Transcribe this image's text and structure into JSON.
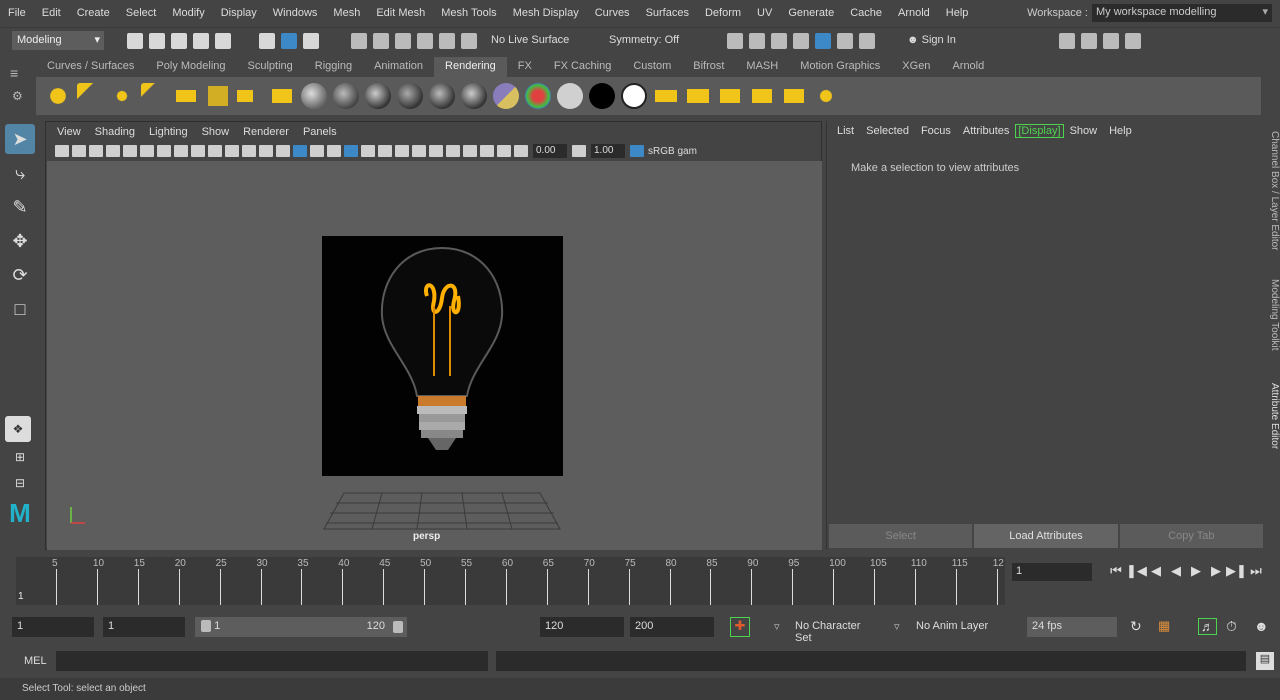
{
  "menubar": {
    "items": [
      "File",
      "Edit",
      "Create",
      "Select",
      "Modify",
      "Display",
      "Windows",
      "Mesh",
      "Edit Mesh",
      "Mesh Tools",
      "Mesh Display",
      "Curves",
      "Surfaces",
      "Deform",
      "UV",
      "Generate",
      "Cache",
      "Arnold",
      "Help"
    ],
    "workspace_label": "Workspace :",
    "workspace_value": "My workspace modelling"
  },
  "statusline": {
    "mode": "Modeling",
    "live_surface": "No Live Surface",
    "symmetry": "Symmetry: Off",
    "sign_in": "Sign In"
  },
  "shelf": {
    "tabs": [
      "Curves / Surfaces",
      "Poly Modeling",
      "Sculpting",
      "Rigging",
      "Animation",
      "Rendering",
      "FX",
      "FX Caching",
      "Custom",
      "Bifrost",
      "MASH",
      "Motion Graphics",
      "XGen",
      "Arnold"
    ],
    "active_tab": "Rendering",
    "icon_colors": [
      "#f0c419",
      "#f0c419",
      "#f0c419",
      "#f0c419",
      "#f0c419",
      "#f0c419",
      "#f0c419",
      "#f0c419",
      "#c8c8c8",
      "#a0a0a0",
      "#a8a8a8",
      "#9a9a9a",
      "#a0a0a0",
      "#9c9c9c",
      "#8a7dbb",
      "#e04040",
      "#d0d0d0",
      "#000000",
      "#ffffff",
      "#f0c419",
      "#f0c419",
      "#f0c419",
      "#f0c419",
      "#f0c419",
      "#f0c419"
    ]
  },
  "viewport": {
    "menu": [
      "View",
      "Shading",
      "Lighting",
      "Show",
      "Renderer",
      "Panels"
    ],
    "field_a": "0.00",
    "field_b": "1.00",
    "color_space": "sRGB gam",
    "camera": "persp"
  },
  "attribute_editor": {
    "menu": [
      "List",
      "Selected",
      "Focus",
      "Attributes",
      "[Display]",
      "Show",
      "Help"
    ],
    "message": "Make a selection to view attributes",
    "buttons": [
      "Select",
      "Load Attributes",
      "Copy Tab"
    ]
  },
  "right_tabs": [
    "Channel Box / Layer Editor",
    "Modeling Toolkit",
    "Attribute Editor"
  ],
  "timeline": {
    "ticks": [
      "5",
      "10",
      "15",
      "20",
      "25",
      "30",
      "35",
      "40",
      "45",
      "50",
      "55",
      "60",
      "65",
      "70",
      "75",
      "80",
      "85",
      "90",
      "95",
      "100",
      "105",
      "110",
      "115",
      "12"
    ],
    "current_frame_marker": "1",
    "current_frame_field": "1"
  },
  "range": {
    "start": "1",
    "playback_start": "1",
    "slider_start": "1",
    "slider_end": "120",
    "playback_end": "120",
    "end": "200",
    "character_set": "No Character Set",
    "anim_layer": "No Anim Layer",
    "fps": "24 fps"
  },
  "command": {
    "label": "MEL"
  },
  "status": {
    "help_line": "Select Tool: select an object"
  }
}
